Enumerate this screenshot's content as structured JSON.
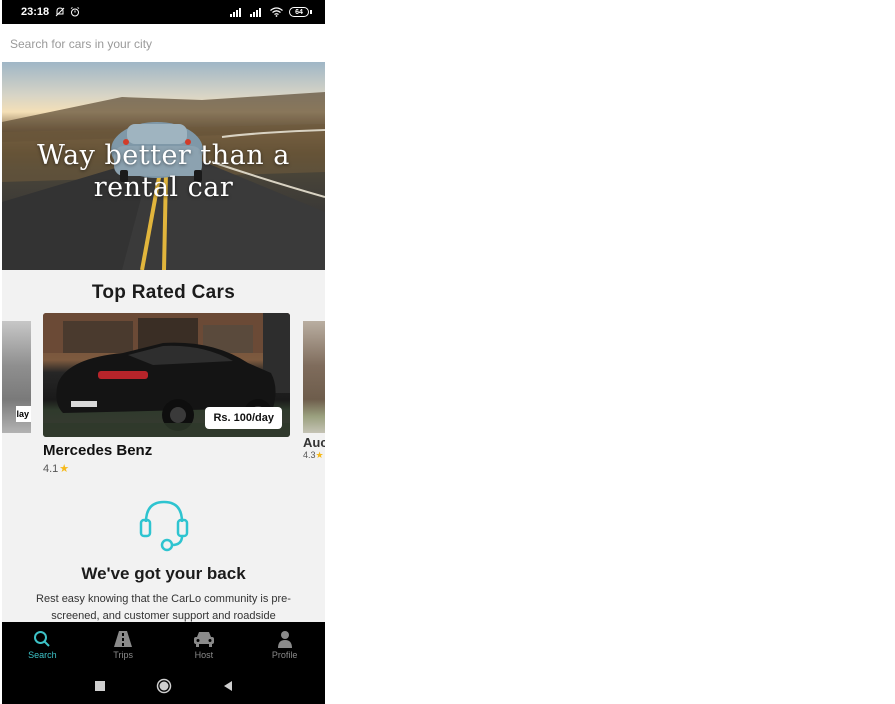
{
  "status_bar": {
    "time": "23:18",
    "battery": "64"
  },
  "search": {
    "placeholder": "Search for cars in your city"
  },
  "hero": {
    "title_line1": "Way better than a",
    "title_line2": "rental car"
  },
  "section": {
    "title": "Top Rated Cars"
  },
  "cars": {
    "left_partial": {
      "price_fragment": "lay"
    },
    "main": {
      "name": "Mercedes Benz",
      "price": "Rs. 100/day",
      "rating": "4.1"
    },
    "right_partial": {
      "name_fragment": "Auc",
      "rating": "4.3"
    }
  },
  "support": {
    "title": "We've got your back",
    "text": "Rest easy knowing that the CarLo community is pre-screened, and customer support and roadside"
  },
  "bottom_nav": {
    "items": [
      {
        "label": "Search",
        "icon": "search-icon"
      },
      {
        "label": "Trips",
        "icon": "road-icon"
      },
      {
        "label": "Host",
        "icon": "car-icon"
      },
      {
        "label": "Profile",
        "icon": "person-icon"
      }
    ]
  },
  "colors": {
    "accent": "#3dc2c7",
    "star": "#f6b919"
  }
}
